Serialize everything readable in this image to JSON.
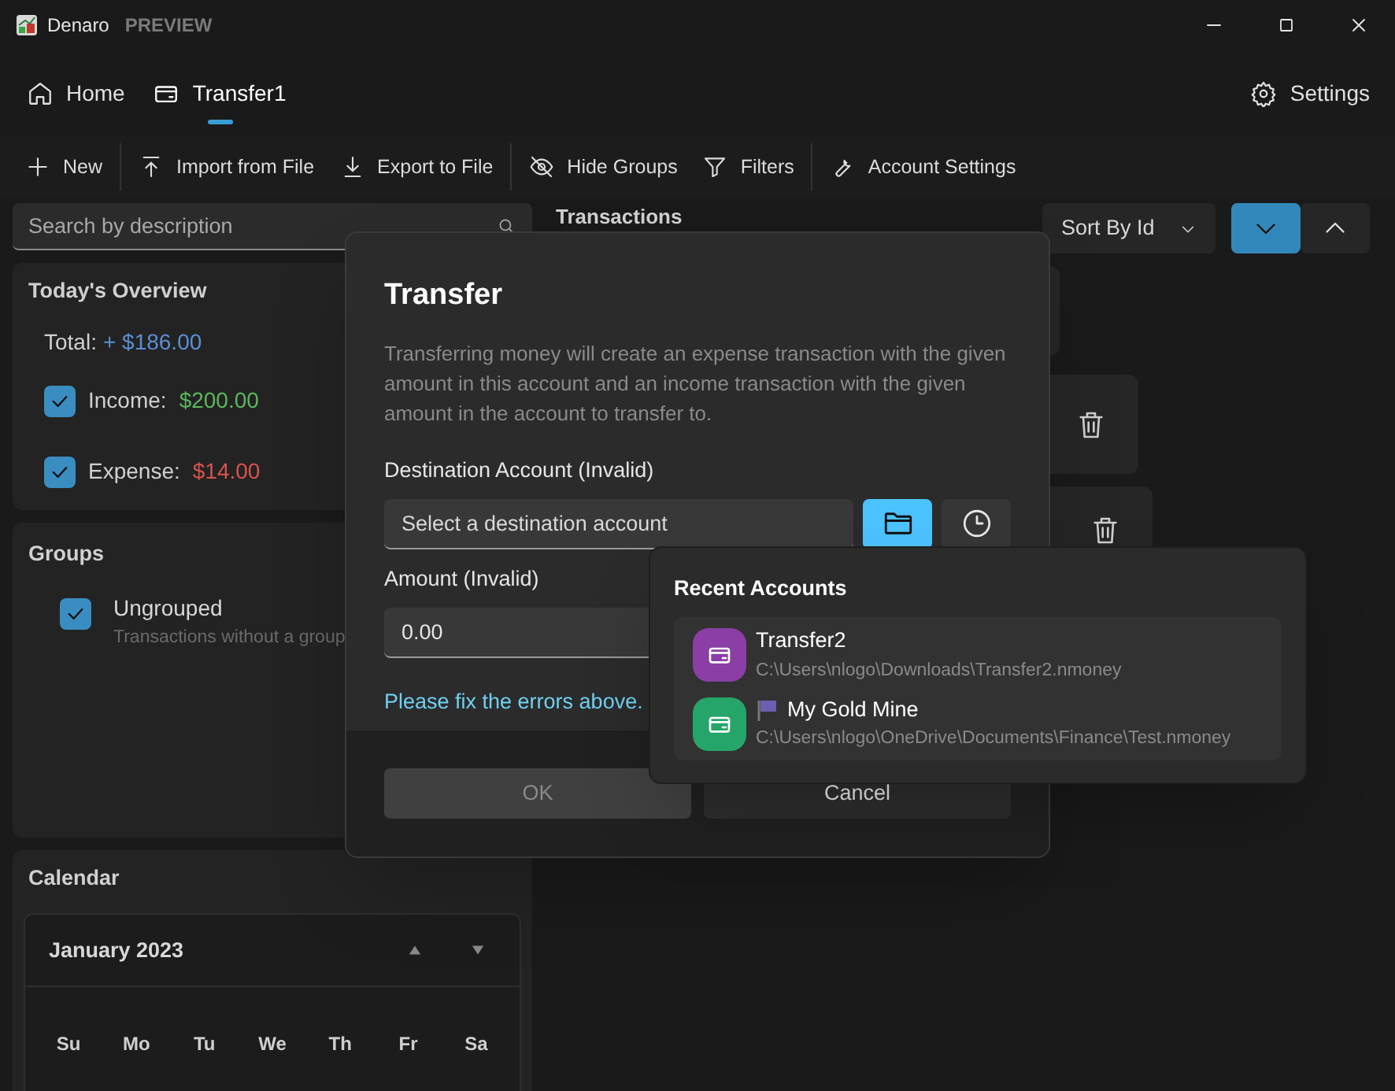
{
  "window": {
    "title": "Denaro",
    "badge": "PREVIEW"
  },
  "nav": {
    "items": [
      {
        "label": "Home",
        "selected": false
      },
      {
        "label": "Transfer1",
        "selected": true
      }
    ],
    "settings": "Settings"
  },
  "toolbar": [
    [
      {
        "label": "New"
      }
    ],
    [
      {
        "label": "Import from File"
      },
      {
        "label": "Export to File"
      }
    ],
    [
      {
        "label": "Hide Groups"
      },
      {
        "label": "Filters"
      }
    ],
    [
      {
        "label": "Account Settings"
      }
    ]
  ],
  "search": {
    "placeholder": "Search by description"
  },
  "overview": {
    "title": "Today's Overview",
    "total_label": "Total:",
    "total": "+ $186.00",
    "rows": [
      {
        "label": "Income:",
        "amount": "$200.00",
        "checked": true,
        "kind": "income"
      },
      {
        "label": "Expense:",
        "amount": "$14.00",
        "checked": true,
        "kind": "expense"
      }
    ]
  },
  "groups": {
    "title": "Groups",
    "items": [
      {
        "name": "Ungrouped",
        "description": "Transactions without a group",
        "checked": true
      }
    ]
  },
  "calendar": {
    "title": "Calendar",
    "month": "January 2023",
    "weekdays": [
      "Su",
      "Mo",
      "Tu",
      "We",
      "Th",
      "Fr",
      "Sa"
    ]
  },
  "transactions": {
    "title": "Transactions",
    "sort": "Sort By Id",
    "sort_buttons": [
      {
        "selected": true
      },
      {
        "selected": false
      }
    ]
  },
  "dialog": {
    "title": "Transfer",
    "description": "Transferring money will create an expense transaction with the given amount in this account and an income transaction with the given amount in the account to transfer to.",
    "destination_label": "Destination Account (Invalid)",
    "destination_placeholder": "Select a destination account",
    "amount_label": "Amount (Invalid)",
    "amount_value": "0.00",
    "error": "Please fix the errors above.",
    "buttons": [
      {
        "label": "OK",
        "disabled": true
      },
      {
        "label": "Cancel",
        "disabled": false
      }
    ]
  },
  "recent_accounts": {
    "title": "Recent Accounts",
    "items": [
      {
        "name": "Transfer2",
        "path": "C:\\Users\\nlogo\\Downloads\\Transfer2.nmoney",
        "color": "#8a3ea6",
        "flagged": false
      },
      {
        "name": "My Gold Mine",
        "path": "C:\\Users\\nlogo\\OneDrive\\Documents\\Finance\\Test.nmoney",
        "color": "#26a56a",
        "flagged": true
      }
    ]
  }
}
